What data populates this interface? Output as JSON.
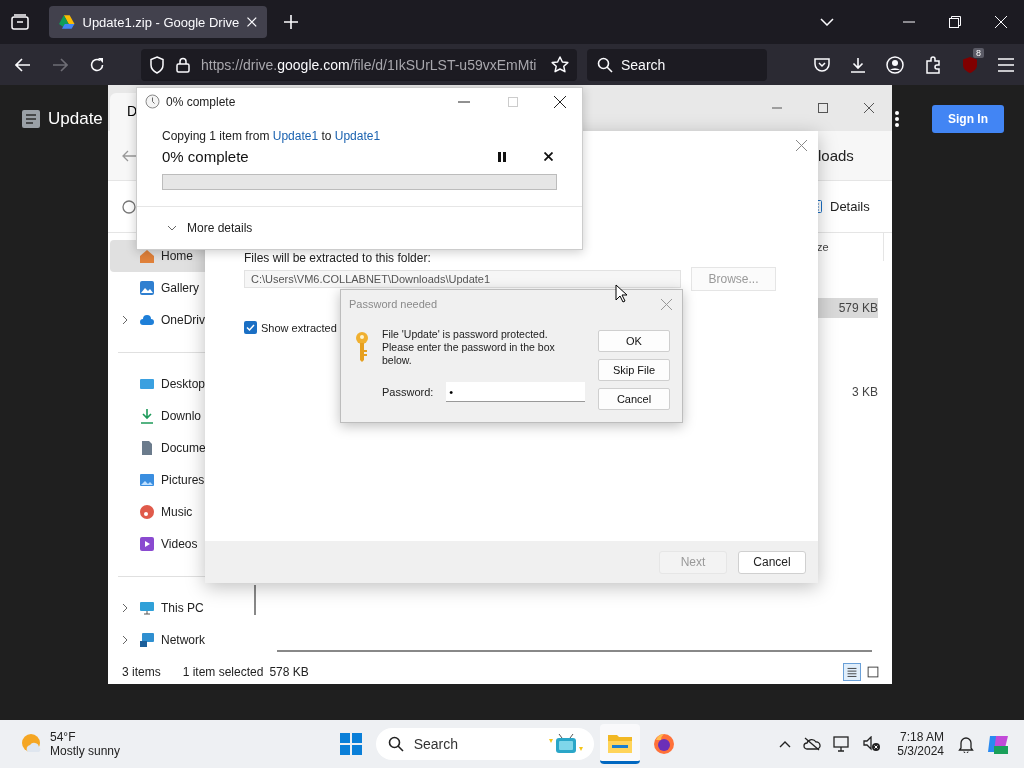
{
  "browser": {
    "tab_title": "Update1.zip - Google Drive",
    "url": "https://drive.**google.com**/file/d/1IkSUrLST-u59vxEmMti",
    "search_placeholder": "Search",
    "extension_badge": "8"
  },
  "drive": {
    "file_title": "Update",
    "sign_in": "Sign In"
  },
  "explorer": {
    "tab_label": "D",
    "breadcrumb": "loads",
    "details_button": "Details",
    "column_header": "ze",
    "sidebar": [
      {
        "kind": "home",
        "label": "Home",
        "selected": true,
        "expandable": false
      },
      {
        "kind": "gallery",
        "label": "Gallery",
        "selected": false,
        "expandable": false
      },
      {
        "kind": "cloud",
        "label": "OneDriv",
        "selected": false,
        "expandable": true
      },
      {
        "kind": "divider"
      },
      {
        "kind": "desktop",
        "label": "Desktop",
        "selected": false,
        "expandable": false
      },
      {
        "kind": "download",
        "label": "Downlo",
        "selected": false,
        "expandable": false
      },
      {
        "kind": "document",
        "label": "Docume",
        "selected": false,
        "expandable": false
      },
      {
        "kind": "picture",
        "label": "Pictures",
        "selected": false,
        "expandable": false
      },
      {
        "kind": "music",
        "label": "Music",
        "selected": false,
        "expandable": false
      },
      {
        "kind": "video",
        "label": "Videos",
        "selected": false,
        "expandable": false
      },
      {
        "kind": "divider"
      },
      {
        "kind": "pc",
        "label": "This PC",
        "selected": false,
        "expandable": true
      },
      {
        "kind": "network",
        "label": "Network",
        "selected": false,
        "expandable": true
      }
    ],
    "rows": [
      {
        "size": "579 KB",
        "selected": true
      },
      {
        "size": "3 KB",
        "selected": false
      }
    ],
    "status": {
      "count": "3 items",
      "selection": "1 item selected",
      "size": "578 KB"
    },
    "view_buttons": [
      {
        "kind": "details",
        "selected": true
      },
      {
        "kind": "tiles",
        "selected": false
      }
    ]
  },
  "wizard": {
    "folder_label": "Files will be extracted to this folder:",
    "path": "C:\\Users\\VM6.COLLABNET\\Downloads\\Update1",
    "browse": {
      "label": "Browse...",
      "disabled": true
    },
    "show_extracted": {
      "label": "Show extracted",
      "checked": true
    },
    "buttons": [
      {
        "label": "Next",
        "disabled": true
      },
      {
        "label": "Cancel",
        "disabled": false
      }
    ]
  },
  "copy_dialog": {
    "title": "0% complete",
    "prefix": "Copying 1 item from ",
    "source": "Update1",
    "middle": " to ",
    "destination": "Update1",
    "progress_title": "0% complete",
    "level": 0,
    "more_details": "More details"
  },
  "password_dialog": {
    "title": "Password needed",
    "message": "File 'Update' is password protected. Please enter the password in the box below.",
    "field_label": "Password:",
    "value": "•",
    "buttons": [
      {
        "label": "OK"
      },
      {
        "label": "Skip File"
      },
      {
        "label": "Cancel"
      }
    ]
  },
  "taskbar": {
    "temperature": "54°F",
    "weather": "Mostly sunny",
    "search_placeholder": "Search",
    "time": "7:18 AM",
    "date": "5/3/2024"
  }
}
